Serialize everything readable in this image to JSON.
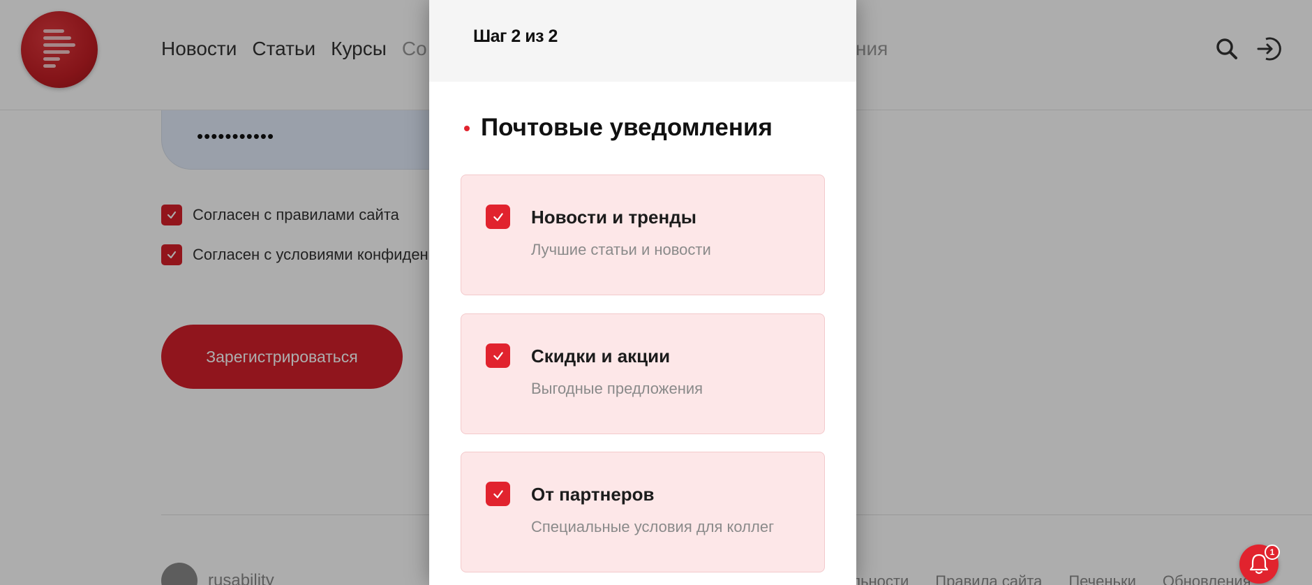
{
  "header": {
    "nav": [
      {
        "label": "Новости"
      },
      {
        "label": "Статьи"
      },
      {
        "label": "Курсы"
      },
      {
        "label": "Со"
      }
    ],
    "nav_right_fragment": "ния"
  },
  "form": {
    "password_value": "•••••••••••",
    "agreements": [
      {
        "label": "Согласен с правилами сайта",
        "checked": true
      },
      {
        "label": "Согласен с условиями конфиден",
        "checked": true
      }
    ],
    "register_label": "Зарегистрироваться"
  },
  "footer": {
    "brand": "rusability",
    "links": [
      "альности",
      "Правила сайта",
      "Печеньки",
      "Обновления"
    ]
  },
  "modal": {
    "step_label": "Шаг 2 из 2",
    "section_title": "Почтовые уведомления",
    "options": [
      {
        "title": "Новости и тренды",
        "subtitle": "Лучшие статьи и новости",
        "checked": true
      },
      {
        "title": "Скидки и акции",
        "subtitle": "Выгодные предложения",
        "checked": true
      },
      {
        "title": "От партнеров",
        "subtitle": "Специальные условия для коллег",
        "checked": true
      }
    ]
  },
  "notifications": {
    "badge_count": "1"
  },
  "colors": {
    "accent": "#e1232e",
    "card_bg": "#fde7e8",
    "overlay": "rgba(0,0,0,0.32)"
  }
}
